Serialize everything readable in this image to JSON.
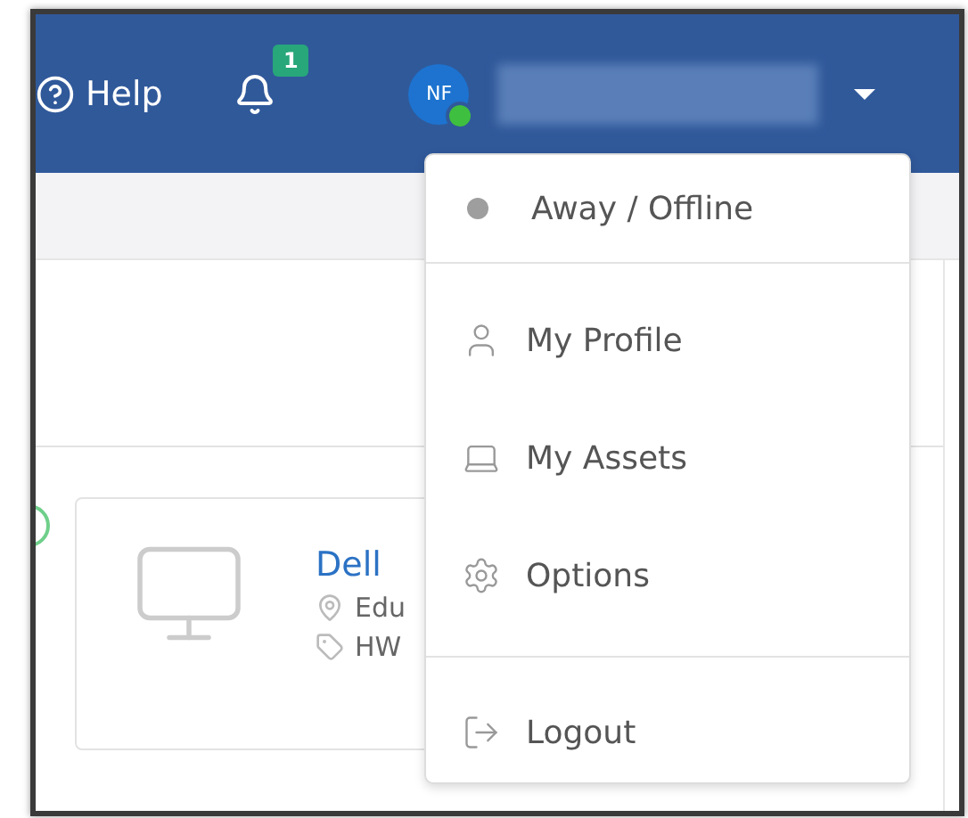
{
  "header": {
    "help": "Help",
    "notifications": {
      "count": "1"
    },
    "user": {
      "initials": "NF",
      "online": true
    }
  },
  "asset_card": {
    "title": "Dell",
    "location": "Edu",
    "tag": "HW"
  },
  "user_menu": {
    "status": {
      "label": "Away / Offline",
      "color": "#9e9e9e"
    },
    "items": [
      {
        "kind": "profile",
        "label": "My Profile"
      },
      {
        "kind": "assets",
        "label": "My Assets"
      },
      {
        "kind": "options",
        "label": "Options"
      }
    ],
    "logout": "Logout"
  }
}
